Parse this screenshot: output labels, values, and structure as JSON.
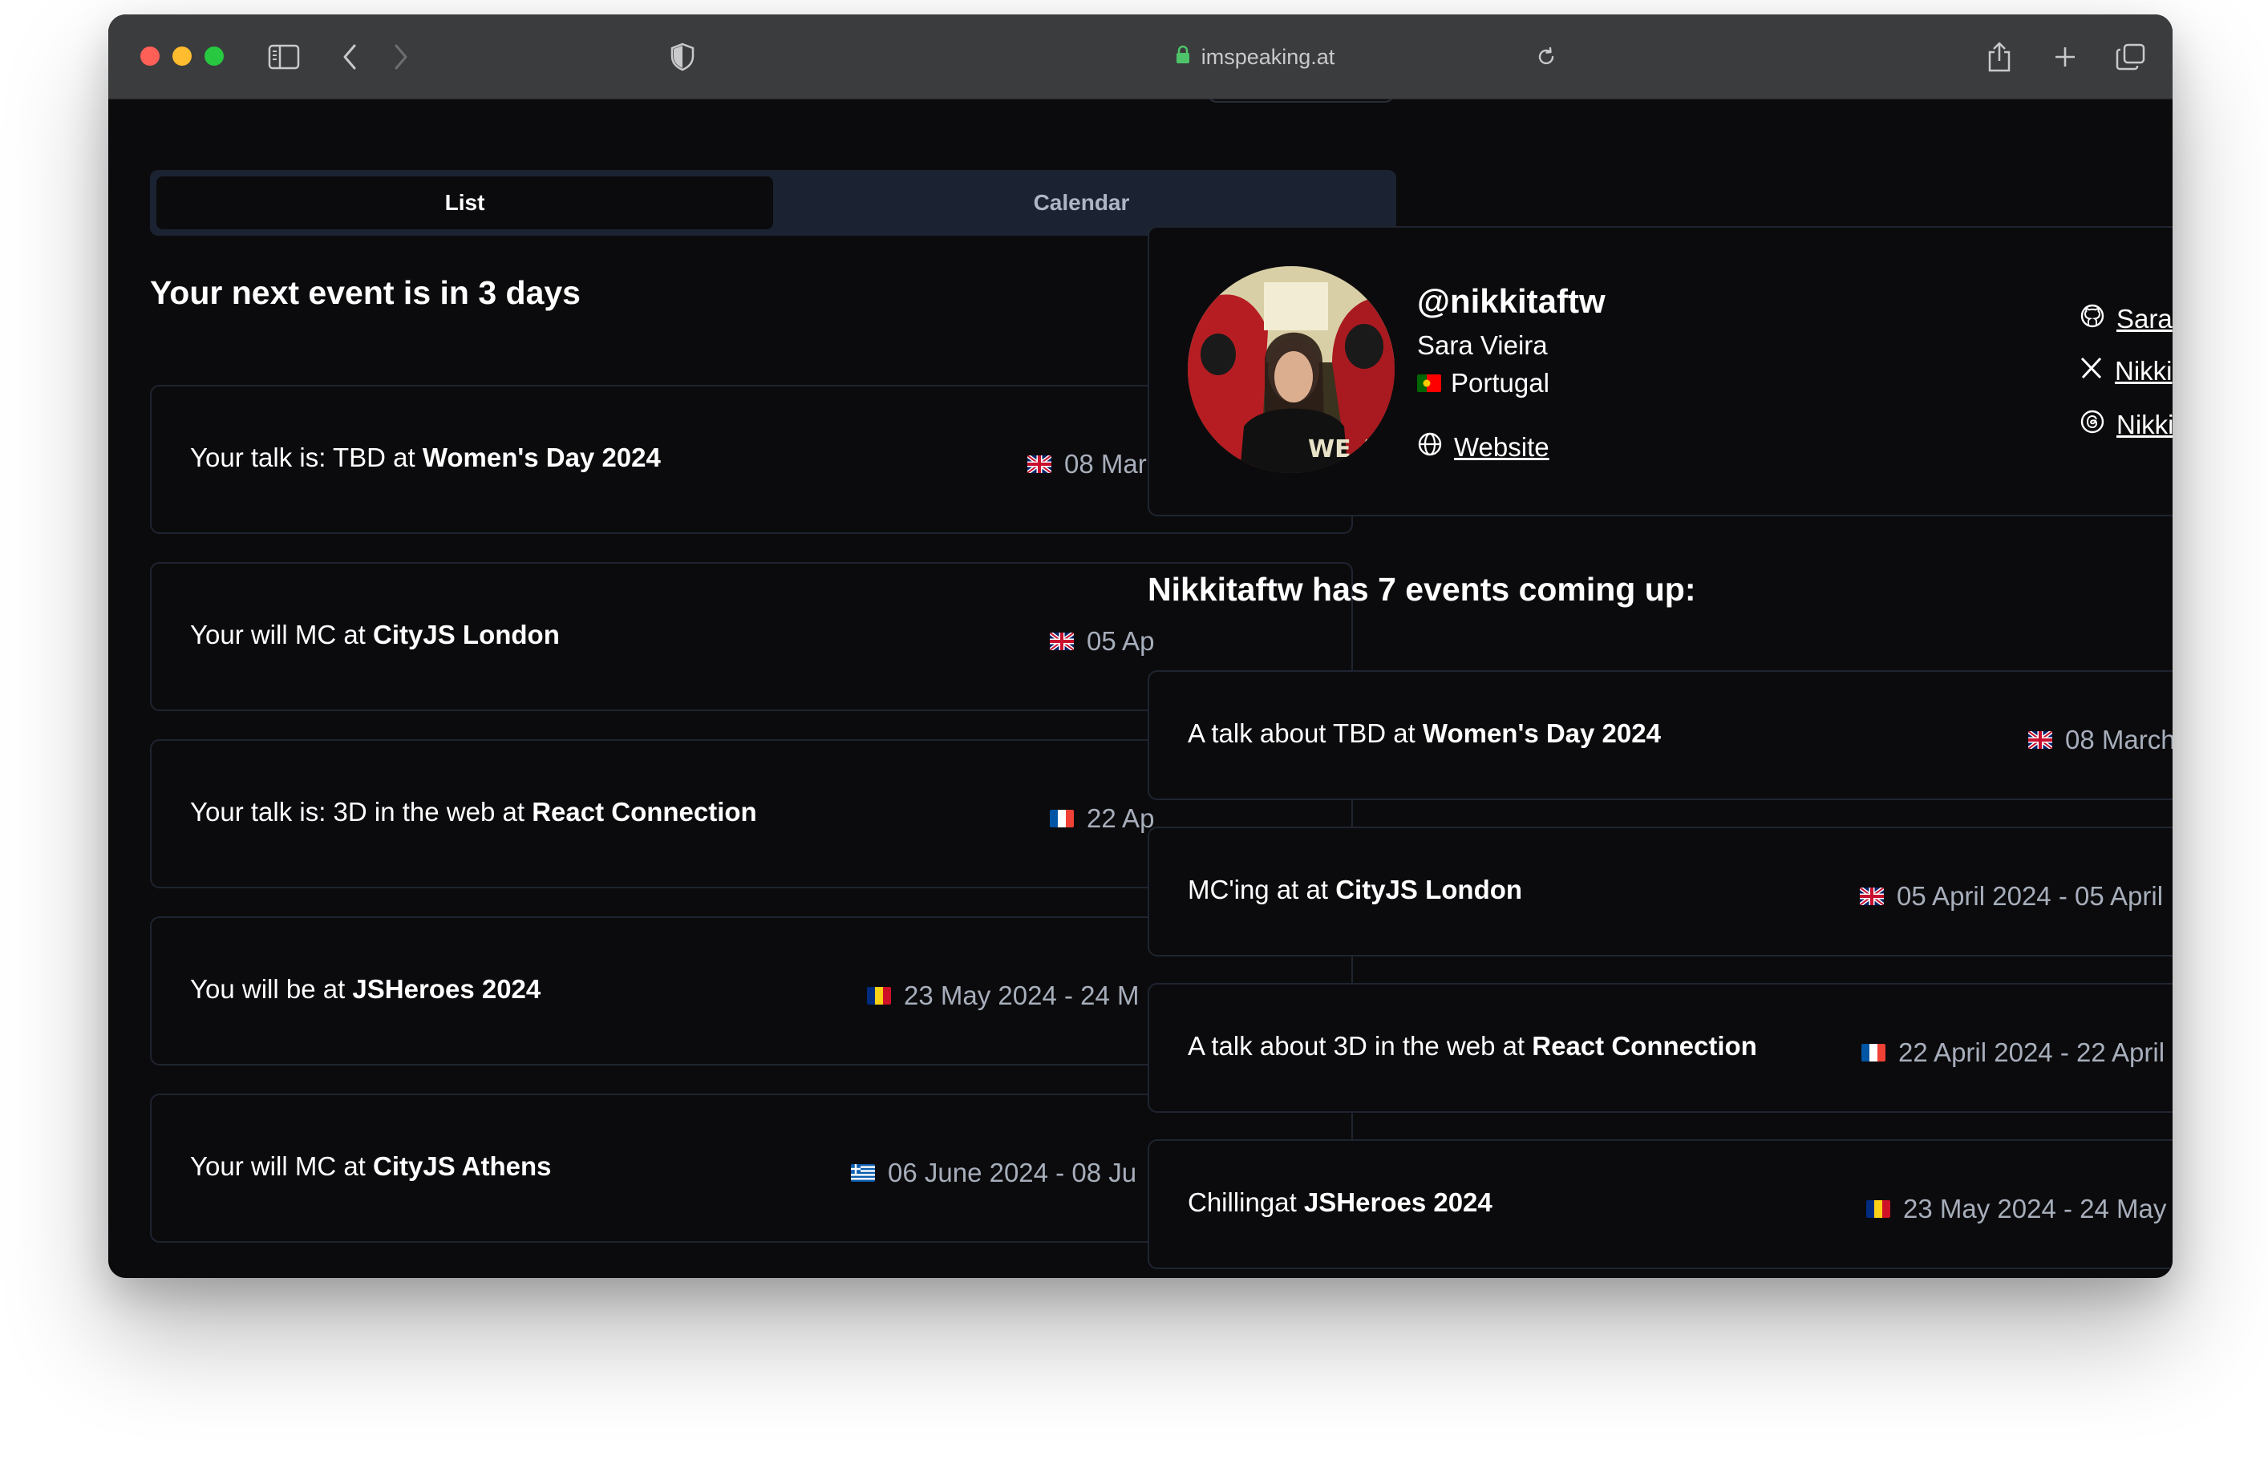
{
  "browser": {
    "url": "imspeaking.at"
  },
  "tabs": [
    {
      "label": "List",
      "active": true
    },
    {
      "label": "Calendar",
      "active": false
    }
  ],
  "next_event_heading": "Your next event is in 3 days",
  "your_events": [
    {
      "prefix": "Your talk is: TBD at ",
      "event": "Women's Day 2024",
      "flag": "uk",
      "date": "08 Mar"
    },
    {
      "prefix": "Your will MC at ",
      "event": "CityJS London",
      "flag": "uk",
      "date": "05 Ap"
    },
    {
      "prefix": "Your talk is: 3D in the web at ",
      "event": "React Connection",
      "flag": "fr",
      "date": "22 Ap"
    },
    {
      "prefix": "You will be at ",
      "event": "JSHeroes 2024",
      "flag": "ro",
      "date": "23 May 2024 - 24 M"
    },
    {
      "prefix": "Your will MC at ",
      "event": "CityJS Athens",
      "flag": "gr",
      "date": "06 June 2024 - 08 Ju"
    }
  ],
  "profile": {
    "handle": "@nikkitaftw",
    "name": "Sara Vieira",
    "country": "Portugal",
    "country_flag": "pt",
    "website_label": "Website",
    "socials": [
      {
        "icon": "github-icon",
        "label": "Sara"
      },
      {
        "icon": "x-icon",
        "label": "Nikki"
      },
      {
        "icon": "threads-icon",
        "label": "Nikki"
      }
    ]
  },
  "coming_heading": "Nikkitaftw has 7 events coming up:",
  "upcoming": [
    {
      "prefix": "A talk about TBD at ",
      "event": "Women's Day 2024",
      "flag": "uk",
      "date": "08 March"
    },
    {
      "prefix": "MC'ing at at ",
      "event": "CityJS London",
      "flag": "uk",
      "date": "05 April 2024 - 05 April"
    },
    {
      "prefix": "A talk about 3D in the web at ",
      "event": "React Connection",
      "flag": "fr",
      "date": "22 April 2024 - 22 April"
    },
    {
      "prefix": "Chillingat ",
      "event": "JSHeroes 2024",
      "flag": "ro",
      "date": "23 May 2024 - 24 May"
    }
  ]
}
